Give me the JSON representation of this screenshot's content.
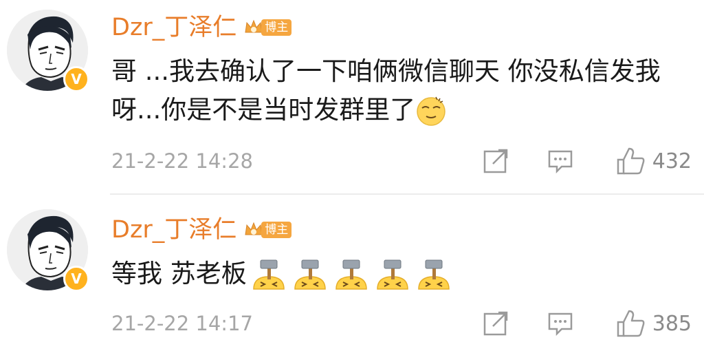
{
  "comments": [
    {
      "username": "Dzr_丁泽仁",
      "vip_label": "博主",
      "text": "哥 ...我去确认了一下咱俩微信聊天 你没私信发我呀...你是不是当时发群里了",
      "emoji": "dizzy-emoji",
      "timestamp": "21-2-22 14:28",
      "likes": "432"
    },
    {
      "username": "Dzr_丁泽仁",
      "vip_label": "博主",
      "text": "等我 苏老板",
      "emoji": "hammer-emoji",
      "emoji_count": 5,
      "timestamp": "21-2-22 14:17",
      "likes": "385"
    }
  ],
  "badge_letter": "V",
  "colors": {
    "username": "#e87d2a",
    "vip_badge": "#f5a640",
    "verified_badge": "#ffb21e",
    "timestamp": "#a6a6a6"
  }
}
